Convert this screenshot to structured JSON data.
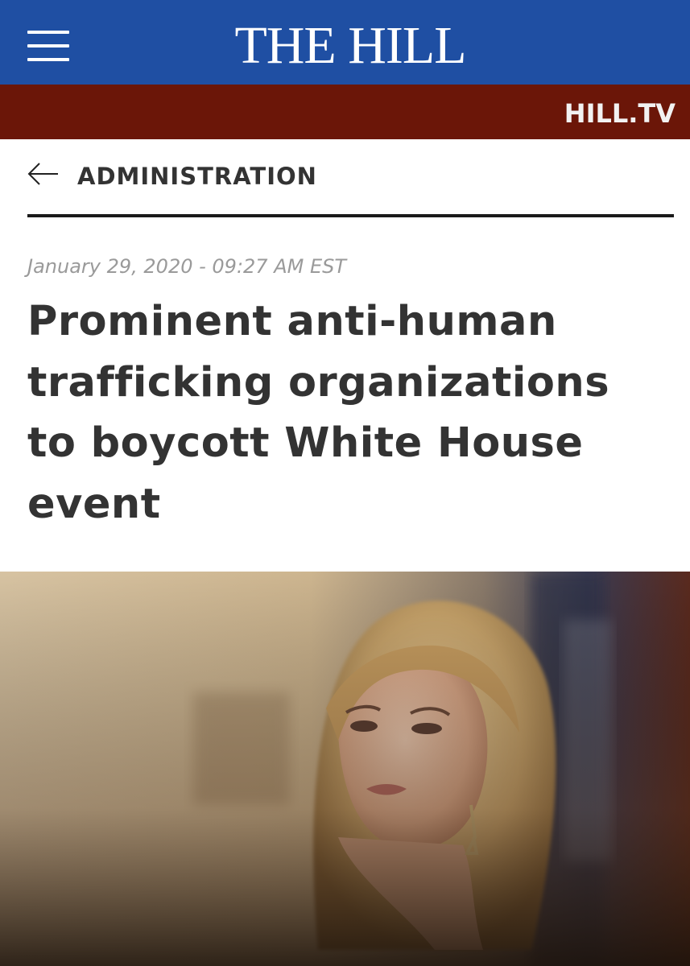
{
  "header": {
    "logo": "THE HILL",
    "menu_icon": "hamburger-menu-icon",
    "brand_color": "#1f4fa3"
  },
  "subbar": {
    "hilltv_label": "HILL.TV",
    "color": "#6b1608"
  },
  "section": {
    "back_icon": "arrow-left-icon",
    "label": "ADMINISTRATION"
  },
  "article": {
    "dateline": "January 29, 2020 - 09:27 AM EST",
    "headline": "Prominent anti-human trafficking organizations to boycott White House event"
  },
  "hero_image": {
    "kind": "photo",
    "subject": "woman-portrait"
  }
}
